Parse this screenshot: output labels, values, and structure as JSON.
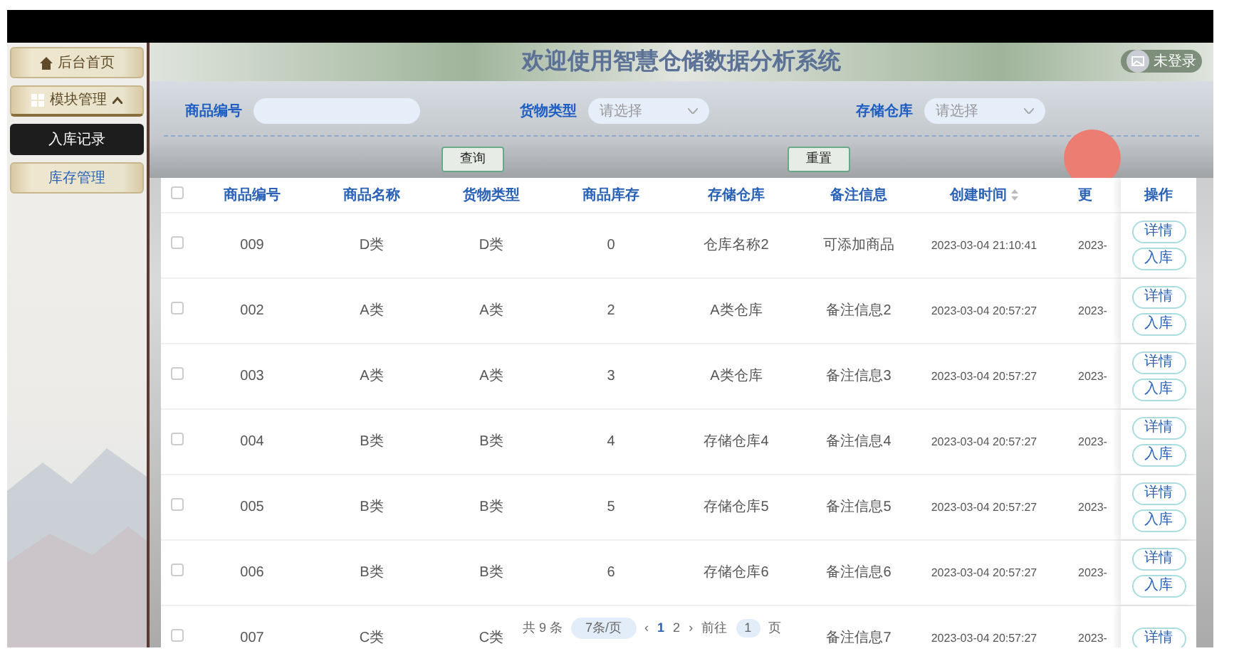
{
  "sidebar": {
    "items": [
      {
        "label": "后台首页",
        "selected": false
      },
      {
        "label": "模块管理",
        "expanded": true,
        "selected": false,
        "children": [
          {
            "label": "入库记录",
            "selected": true
          },
          {
            "label": "库存管理",
            "selected": false
          }
        ]
      }
    ]
  },
  "header": {
    "title": "欢迎使用智慧仓储数据分析系统",
    "user": "未登录"
  },
  "filters": [
    {
      "label": "商品编号",
      "kind": "text"
    },
    {
      "label": "货物类型",
      "kind": "select",
      "placeholder": "请选择"
    },
    {
      "label": "存储仓库",
      "kind": "select",
      "placeholder": "请选择"
    }
  ],
  "buttons": [
    "查询",
    "重置"
  ],
  "table": {
    "header_checked": false,
    "columns": [
      "商品编号",
      "商品名称",
      "货物类型",
      "商品库存",
      "存储仓库",
      "备注信息",
      "创建时间",
      "更"
    ],
    "actions_title": "操作",
    "rows": [
      {
        "checked": false,
        "cells": [
          "009",
          "D类",
          "D类",
          "0",
          "仓库名称2",
          "可添加商品",
          "2023-03-04 21:10:41",
          "2023-"
        ],
        "actions": [
          "详情",
          "入库"
        ]
      },
      {
        "checked": false,
        "cells": [
          "002",
          "A类",
          "A类",
          "2",
          "A类仓库",
          "备注信息2",
          "2023-03-04 20:57:27",
          "2023-"
        ],
        "actions": [
          "详情",
          "入库"
        ]
      },
      {
        "checked": false,
        "cells": [
          "003",
          "A类",
          "A类",
          "3",
          "A类仓库",
          "备注信息3",
          "2023-03-04 20:57:27",
          "2023-"
        ],
        "actions": [
          "详情",
          "入库"
        ]
      },
      {
        "checked": false,
        "cells": [
          "004",
          "B类",
          "B类",
          "4",
          "存储仓库4",
          "备注信息4",
          "2023-03-04 20:57:27",
          "2023-"
        ],
        "actions": [
          "详情",
          "入库"
        ]
      },
      {
        "checked": false,
        "cells": [
          "005",
          "B类",
          "B类",
          "5",
          "存储仓库5",
          "备注信息5",
          "2023-03-04 20:57:27",
          "2023-"
        ],
        "actions": [
          "详情",
          "入库"
        ]
      },
      {
        "checked": false,
        "cells": [
          "006",
          "B类",
          "B类",
          "6",
          "存储仓库6",
          "备注信息6",
          "2023-03-04 20:57:27",
          "2023-"
        ],
        "actions": [
          "详情",
          "入库"
        ]
      },
      {
        "checked": false,
        "cells": [
          "007",
          "C类",
          "C类",
          null,
          null,
          "备注信息7",
          "2023-03-04 20:57:27",
          "2023-"
        ],
        "actions": [
          "详情"
        ]
      }
    ]
  },
  "pagination": {
    "total": "共 9 条",
    "page_size": "7条/页",
    "prev": "‹",
    "pages": [
      {
        "label": "1",
        "selected": true
      },
      {
        "label": "2",
        "selected": false
      }
    ],
    "next": "›",
    "goto_label": "前往",
    "goto_value": "1",
    "goto_suffix": "页"
  }
}
